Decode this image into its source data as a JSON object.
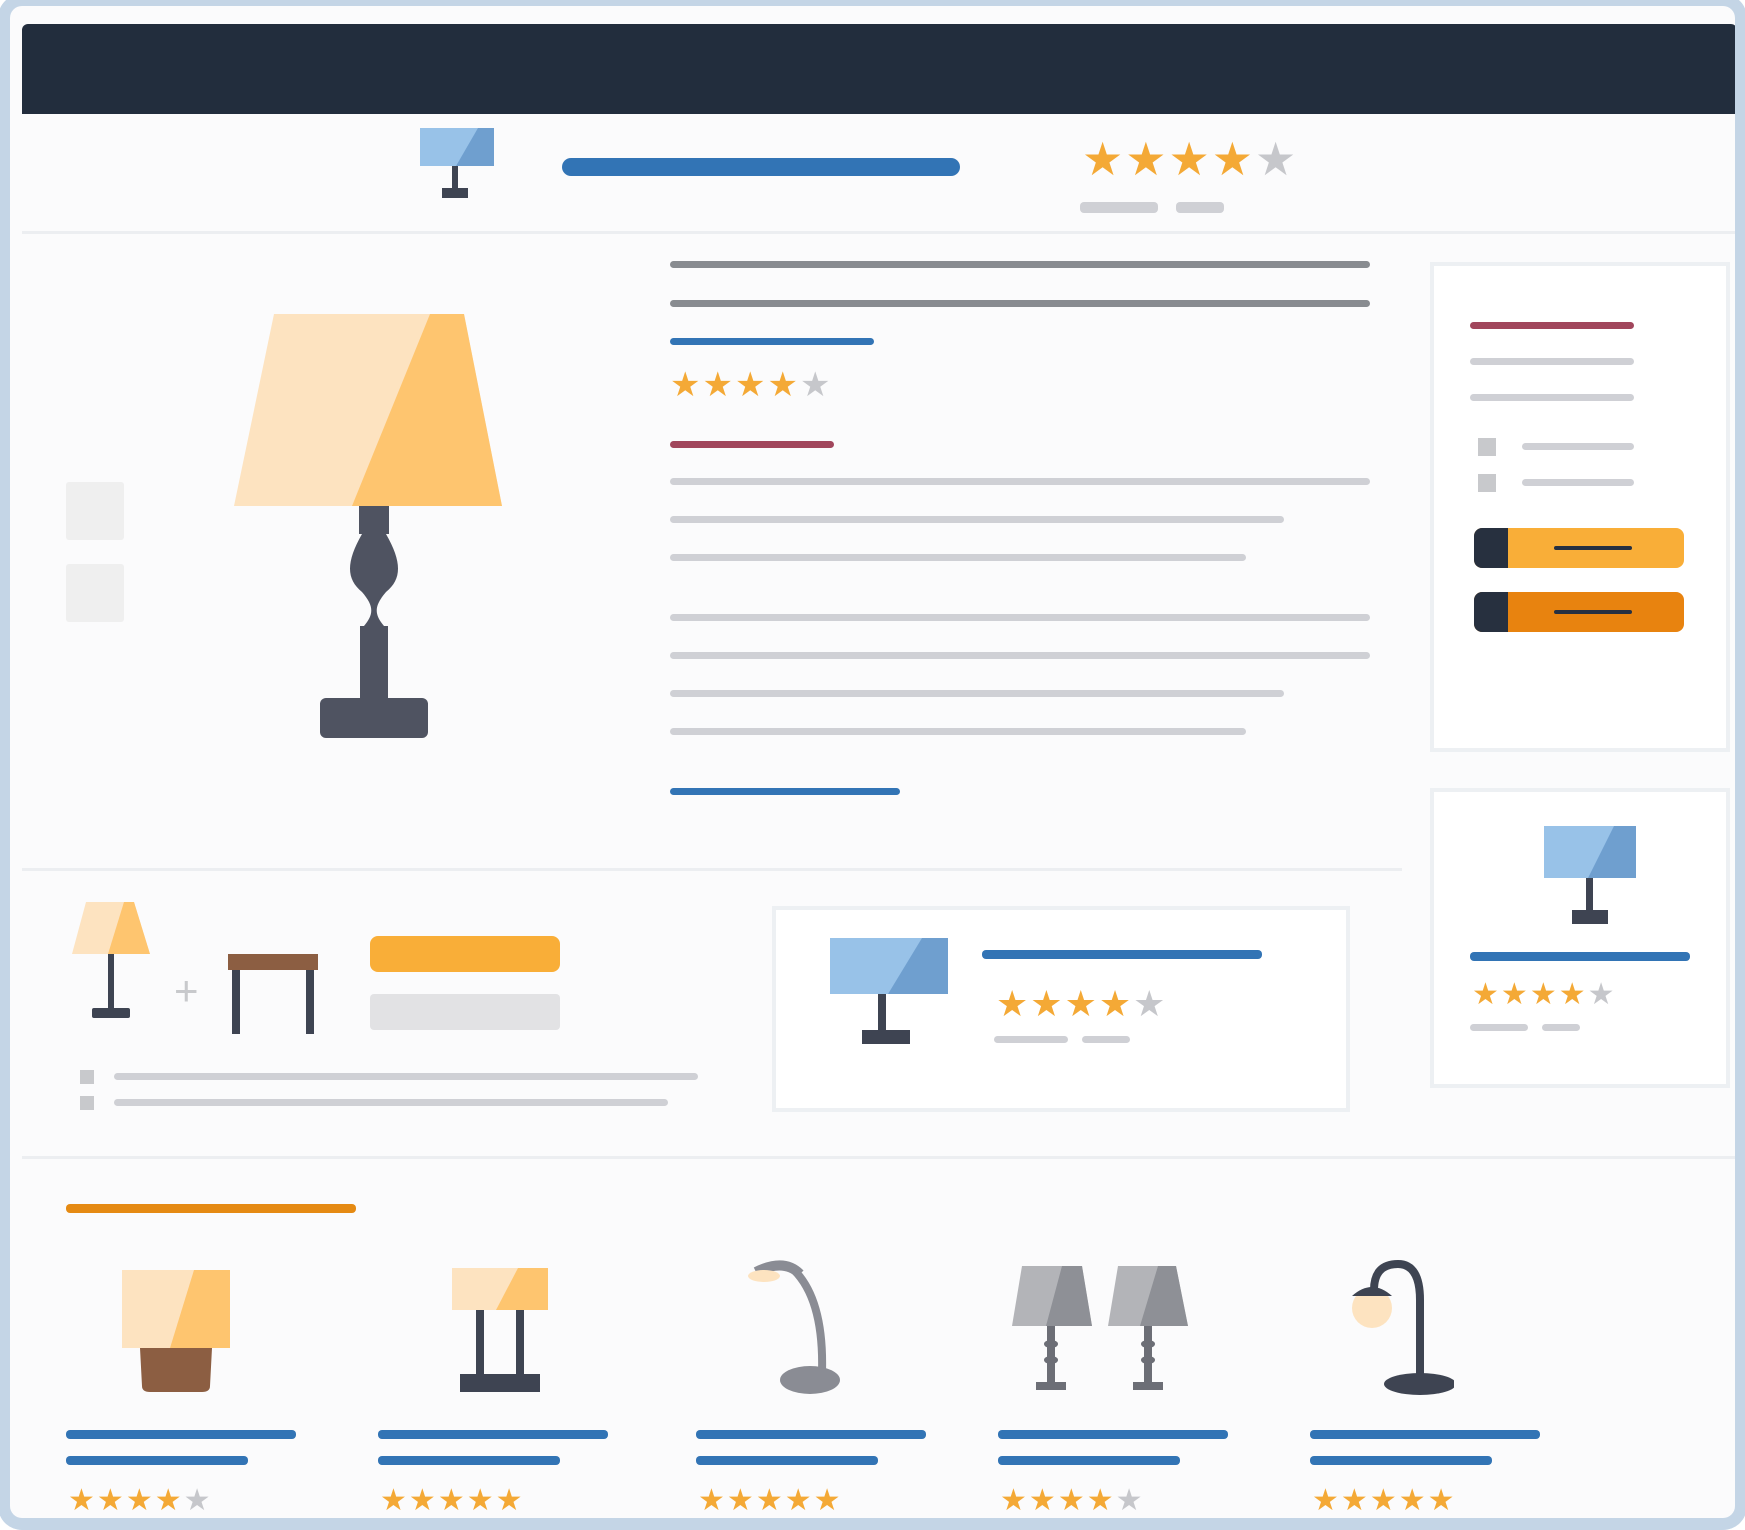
{
  "colors": {
    "topbar": "#222d3d",
    "frame": "#c4d5e6",
    "link_blue": "#3274b5",
    "star_on": "#f4a936",
    "star_off": "#c6c7cb",
    "add_to_cart": "#f9ae38",
    "buy_now": "#e8830f",
    "heading_red": "#a1465c",
    "section_orange": "#e58a13"
  },
  "header": {
    "product_icon": "desk-lamp-icon",
    "rating": 4
  },
  "product": {
    "rating": 4,
    "image_icon": "table-lamp-icon"
  },
  "buy_box": {
    "buttons": [
      {
        "name": "add-to-cart-button",
        "color": "#f9ae38"
      },
      {
        "name": "buy-now-button",
        "color": "#e8830f"
      }
    ]
  },
  "bundle": {
    "items": [
      "lamp-icon",
      "side-table-icon"
    ],
    "plus": "+"
  },
  "sponsored": {
    "rating": 4,
    "icon": "desk-lamp-icon"
  },
  "sidebar_ad": {
    "rating": 4,
    "icon": "desk-lamp-icon"
  },
  "related": {
    "items": [
      {
        "icon": "cube-lamp-icon",
        "rating": 4
      },
      {
        "icon": "pillar-lamp-icon",
        "rating": 5
      },
      {
        "icon": "gooseneck-desk-lamp-icon",
        "rating": 5
      },
      {
        "icon": "lamp-pair-icon",
        "rating": 4
      },
      {
        "icon": "arc-lamp-icon",
        "rating": 5
      }
    ]
  }
}
